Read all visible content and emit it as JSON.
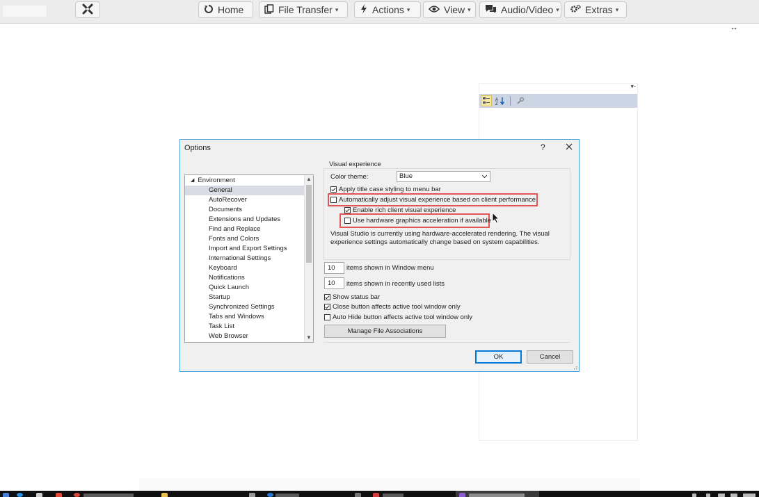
{
  "remote_toolbar": {
    "buttons": [
      {
        "label": "Home"
      },
      {
        "label": "File Transfer"
      },
      {
        "label": "Actions"
      },
      {
        "label": "View"
      },
      {
        "label": "Audio/Video"
      },
      {
        "label": "Extras"
      }
    ]
  },
  "dialog": {
    "title": "Options",
    "help_glyph": "?",
    "tree": {
      "root": "Environment",
      "items": [
        "General",
        "AutoRecover",
        "Documents",
        "Extensions and Updates",
        "Find and Replace",
        "Fonts and Colors",
        "Import and Export Settings",
        "International Settings",
        "Keyboard",
        "Notifications",
        "Quick Launch",
        "Startup",
        "Synchronized Settings",
        "Tabs and Windows",
        "Task List",
        "Web Browser"
      ],
      "selected": "General"
    },
    "visual_experience": {
      "group_label": "Visual experience",
      "color_theme_label": "Color theme:",
      "color_theme_value": "Blue",
      "apply_title_case": {
        "label": "Apply title case styling to menu bar",
        "checked": true
      },
      "auto_adjust": {
        "label": "Automatically adjust visual experience based on client performance",
        "checked": false
      },
      "rich_client": {
        "label": "Enable rich client visual experience",
        "checked": true
      },
      "hardware_accel": {
        "label": "Use hardware graphics acceleration if available",
        "checked": false
      },
      "info": "Visual Studio is currently using hardware-accelerated rendering. The visual experience settings automatically change based on system capabilities."
    },
    "window_menu": {
      "value": "10",
      "label": "items shown in Window menu"
    },
    "recent_lists": {
      "value": "10",
      "label": "items shown in recently used lists"
    },
    "show_status_bar": {
      "label": "Show status bar",
      "checked": true
    },
    "close_button": {
      "label": "Close button affects active tool window only",
      "checked": true
    },
    "auto_hide": {
      "label": "Auto Hide button affects active tool window only",
      "checked": false
    },
    "manage_button": "Manage File Associations",
    "ok_button": "OK",
    "cancel_button": "Cancel"
  },
  "colors": {
    "dialog_border": "#4a9fd6",
    "highlight": "#e05555",
    "selection": "#d8dbe3",
    "property_toolbar": "#ccd5e3"
  }
}
